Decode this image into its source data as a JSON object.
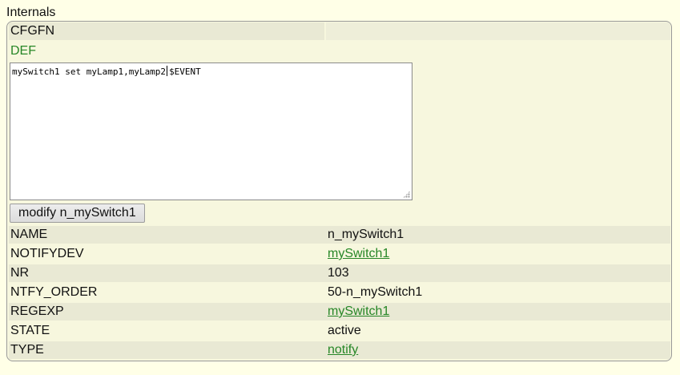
{
  "section": {
    "title": "Internals"
  },
  "cfgfn": {
    "key": "CFGFN",
    "value": ""
  },
  "def": {
    "label": "DEF",
    "text_before_caret": "mySwitch1 set myLamp1,myLamp2",
    "text_after_caret": "$EVENT"
  },
  "modify_button": {
    "label": "modify n_mySwitch1"
  },
  "rows": [
    {
      "key": "NAME",
      "value": "n_mySwitch1",
      "is_link": false
    },
    {
      "key": "NOTIFYDEV",
      "value": "mySwitch1",
      "is_link": true
    },
    {
      "key": "NR",
      "value": "103",
      "is_link": false
    },
    {
      "key": "NTFY_ORDER",
      "value": "50-n_mySwitch1",
      "is_link": false
    },
    {
      "key": "REGEXP",
      "value": "mySwitch1",
      "is_link": true
    },
    {
      "key": "STATE",
      "value": "active",
      "is_link": false
    },
    {
      "key": "TYPE",
      "value": "notify",
      "is_link": true
    }
  ],
  "colors": {
    "page_bg": "#FFFFE7",
    "panel_bg": "#F7F7DE",
    "row_alt_bg": "#E9E9D4",
    "link": "#278727"
  }
}
